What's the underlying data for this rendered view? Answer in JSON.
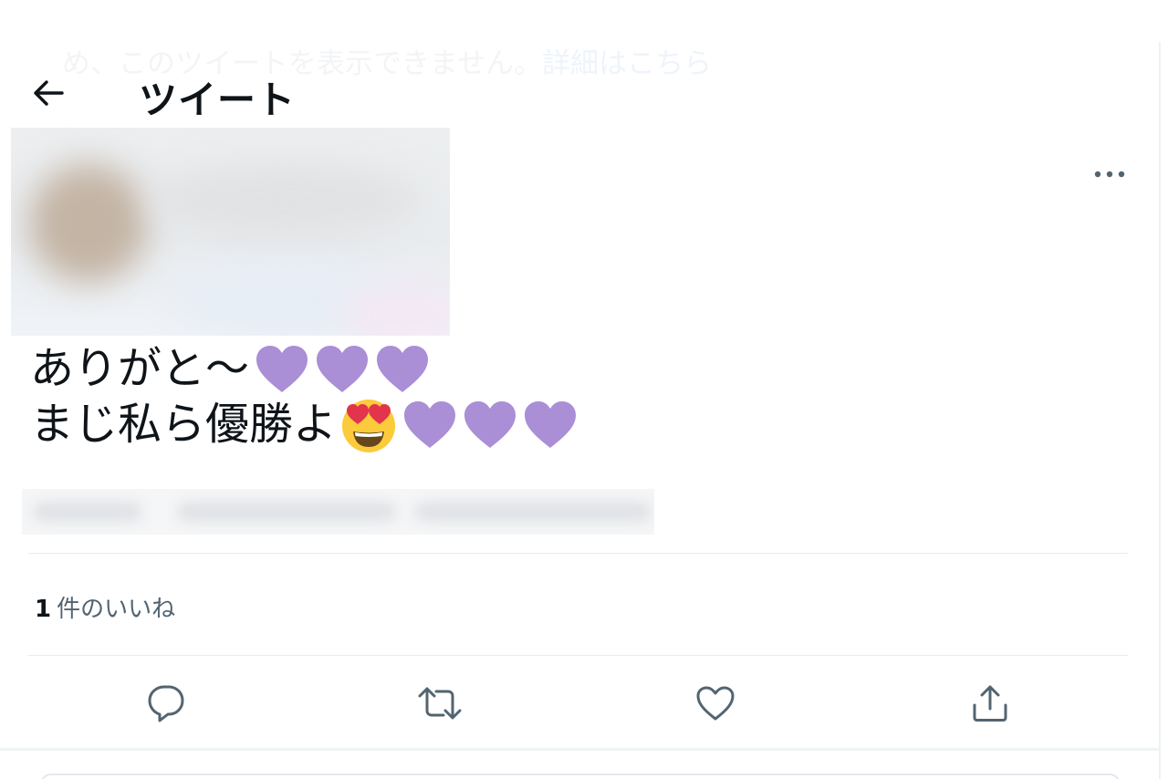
{
  "background_notice": {
    "text": "め、このツイートを表示できません。",
    "link": "詳細はこちら"
  },
  "header": {
    "title": "ツイート",
    "back_icon": "arrow-left-icon"
  },
  "tweet": {
    "more_icon": "more-dots-icon",
    "line1": "ありがと〜",
    "line2": "まじ私ら優勝よ",
    "line1_emoji": [
      "purple-heart",
      "purple-heart",
      "purple-heart"
    ],
    "line2_emoji": [
      "smiling-face-with-heart-eyes",
      "purple-heart",
      "purple-heart",
      "purple-heart"
    ]
  },
  "stats": {
    "likes_count": "1",
    "likes_label": "件のいいね"
  },
  "actions": [
    {
      "icon": "reply-icon"
    },
    {
      "icon": "retweet-icon"
    },
    {
      "icon": "like-icon"
    },
    {
      "icon": "share-icon"
    }
  ],
  "colors": {
    "text_primary": "#0f1419",
    "text_secondary": "#536471",
    "purple_heart": "#aa8ed6",
    "divider": "#e6ecf0"
  }
}
